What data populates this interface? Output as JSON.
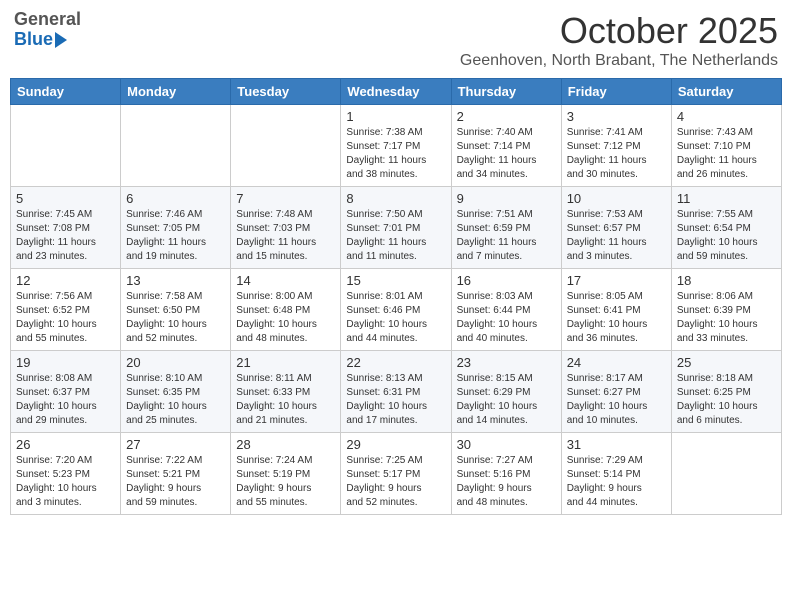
{
  "logo": {
    "general": "General",
    "blue": "Blue"
  },
  "title": "October 2025",
  "location": "Geenhoven, North Brabant, The Netherlands",
  "days_of_week": [
    "Sunday",
    "Monday",
    "Tuesday",
    "Wednesday",
    "Thursday",
    "Friday",
    "Saturday"
  ],
  "weeks": [
    [
      {
        "day": "",
        "info": ""
      },
      {
        "day": "",
        "info": ""
      },
      {
        "day": "",
        "info": ""
      },
      {
        "day": "1",
        "info": "Sunrise: 7:38 AM\nSunset: 7:17 PM\nDaylight: 11 hours\nand 38 minutes."
      },
      {
        "day": "2",
        "info": "Sunrise: 7:40 AM\nSunset: 7:14 PM\nDaylight: 11 hours\nand 34 minutes."
      },
      {
        "day": "3",
        "info": "Sunrise: 7:41 AM\nSunset: 7:12 PM\nDaylight: 11 hours\nand 30 minutes."
      },
      {
        "day": "4",
        "info": "Sunrise: 7:43 AM\nSunset: 7:10 PM\nDaylight: 11 hours\nand 26 minutes."
      }
    ],
    [
      {
        "day": "5",
        "info": "Sunrise: 7:45 AM\nSunset: 7:08 PM\nDaylight: 11 hours\nand 23 minutes."
      },
      {
        "day": "6",
        "info": "Sunrise: 7:46 AM\nSunset: 7:05 PM\nDaylight: 11 hours\nand 19 minutes."
      },
      {
        "day": "7",
        "info": "Sunrise: 7:48 AM\nSunset: 7:03 PM\nDaylight: 11 hours\nand 15 minutes."
      },
      {
        "day": "8",
        "info": "Sunrise: 7:50 AM\nSunset: 7:01 PM\nDaylight: 11 hours\nand 11 minutes."
      },
      {
        "day": "9",
        "info": "Sunrise: 7:51 AM\nSunset: 6:59 PM\nDaylight: 11 hours\nand 7 minutes."
      },
      {
        "day": "10",
        "info": "Sunrise: 7:53 AM\nSunset: 6:57 PM\nDaylight: 11 hours\nand 3 minutes."
      },
      {
        "day": "11",
        "info": "Sunrise: 7:55 AM\nSunset: 6:54 PM\nDaylight: 10 hours\nand 59 minutes."
      }
    ],
    [
      {
        "day": "12",
        "info": "Sunrise: 7:56 AM\nSunset: 6:52 PM\nDaylight: 10 hours\nand 55 minutes."
      },
      {
        "day": "13",
        "info": "Sunrise: 7:58 AM\nSunset: 6:50 PM\nDaylight: 10 hours\nand 52 minutes."
      },
      {
        "day": "14",
        "info": "Sunrise: 8:00 AM\nSunset: 6:48 PM\nDaylight: 10 hours\nand 48 minutes."
      },
      {
        "day": "15",
        "info": "Sunrise: 8:01 AM\nSunset: 6:46 PM\nDaylight: 10 hours\nand 44 minutes."
      },
      {
        "day": "16",
        "info": "Sunrise: 8:03 AM\nSunset: 6:44 PM\nDaylight: 10 hours\nand 40 minutes."
      },
      {
        "day": "17",
        "info": "Sunrise: 8:05 AM\nSunset: 6:41 PM\nDaylight: 10 hours\nand 36 minutes."
      },
      {
        "day": "18",
        "info": "Sunrise: 8:06 AM\nSunset: 6:39 PM\nDaylight: 10 hours\nand 33 minutes."
      }
    ],
    [
      {
        "day": "19",
        "info": "Sunrise: 8:08 AM\nSunset: 6:37 PM\nDaylight: 10 hours\nand 29 minutes."
      },
      {
        "day": "20",
        "info": "Sunrise: 8:10 AM\nSunset: 6:35 PM\nDaylight: 10 hours\nand 25 minutes."
      },
      {
        "day": "21",
        "info": "Sunrise: 8:11 AM\nSunset: 6:33 PM\nDaylight: 10 hours\nand 21 minutes."
      },
      {
        "day": "22",
        "info": "Sunrise: 8:13 AM\nSunset: 6:31 PM\nDaylight: 10 hours\nand 17 minutes."
      },
      {
        "day": "23",
        "info": "Sunrise: 8:15 AM\nSunset: 6:29 PM\nDaylight: 10 hours\nand 14 minutes."
      },
      {
        "day": "24",
        "info": "Sunrise: 8:17 AM\nSunset: 6:27 PM\nDaylight: 10 hours\nand 10 minutes."
      },
      {
        "day": "25",
        "info": "Sunrise: 8:18 AM\nSunset: 6:25 PM\nDaylight: 10 hours\nand 6 minutes."
      }
    ],
    [
      {
        "day": "26",
        "info": "Sunrise: 7:20 AM\nSunset: 5:23 PM\nDaylight: 10 hours\nand 3 minutes."
      },
      {
        "day": "27",
        "info": "Sunrise: 7:22 AM\nSunset: 5:21 PM\nDaylight: 9 hours\nand 59 minutes."
      },
      {
        "day": "28",
        "info": "Sunrise: 7:24 AM\nSunset: 5:19 PM\nDaylight: 9 hours\nand 55 minutes."
      },
      {
        "day": "29",
        "info": "Sunrise: 7:25 AM\nSunset: 5:17 PM\nDaylight: 9 hours\nand 52 minutes."
      },
      {
        "day": "30",
        "info": "Sunrise: 7:27 AM\nSunset: 5:16 PM\nDaylight: 9 hours\nand 48 minutes."
      },
      {
        "day": "31",
        "info": "Sunrise: 7:29 AM\nSunset: 5:14 PM\nDaylight: 9 hours\nand 44 minutes."
      },
      {
        "day": "",
        "info": ""
      }
    ]
  ]
}
